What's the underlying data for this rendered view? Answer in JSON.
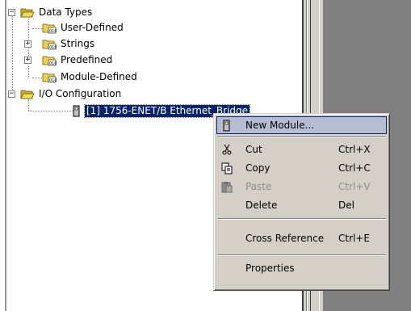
{
  "tree": {
    "items": [
      {
        "label": "Data Types",
        "expander": "−"
      },
      {
        "label": "User-Defined",
        "expander": ""
      },
      {
        "label": "Strings",
        "expander": "+"
      },
      {
        "label": "Predefined",
        "expander": "+"
      },
      {
        "label": "Module-Defined",
        "expander": ""
      },
      {
        "label": "I/O Configuration",
        "expander": "−"
      },
      {
        "label": "[1] 1756-ENET/B Ethernet_Bridge",
        "expander": ""
      }
    ]
  },
  "context_menu": {
    "items": [
      {
        "label": "New Module...",
        "shortcut": "",
        "icon": "module-icon"
      },
      {
        "label": "Cut",
        "shortcut": "Ctrl+X",
        "icon": "scissors-icon"
      },
      {
        "label": "Copy",
        "shortcut": "Ctrl+C",
        "icon": "copy-icon"
      },
      {
        "label": "Paste",
        "shortcut": "Ctrl+V",
        "icon": "paste-icon"
      },
      {
        "label": "Delete",
        "shortcut": "Del",
        "icon": ""
      },
      {
        "label": "Cross Reference",
        "shortcut": "Ctrl+E",
        "icon": ""
      },
      {
        "label": "Properties",
        "shortcut": "",
        "icon": ""
      }
    ]
  },
  "colors": {
    "selection": "#0a246a",
    "menu_highlight": "#b6bdd2",
    "face": "#d4d0c8",
    "workspace": "#808080",
    "folder": "#e8d44d"
  }
}
